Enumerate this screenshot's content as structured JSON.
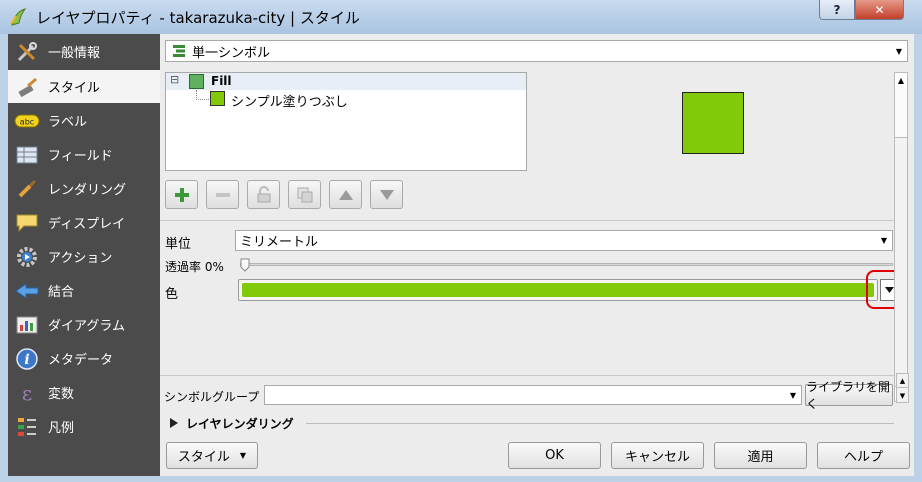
{
  "window": {
    "title": "レイヤプロパティ - takarazuka-city | スタイル",
    "help_label": "?",
    "close_label": "✕"
  },
  "sidebar": {
    "items": [
      {
        "label": "一般情報",
        "icon": "tools-icon"
      },
      {
        "label": "スタイル",
        "icon": "paintbrush-icon"
      },
      {
        "label": "ラベル",
        "icon": "abc-label-icon"
      },
      {
        "label": "フィールド",
        "icon": "table-icon"
      },
      {
        "label": "レンダリング",
        "icon": "brush-icon"
      },
      {
        "label": "ディスプレイ",
        "icon": "speech-bubble-icon"
      },
      {
        "label": "アクション",
        "icon": "gear-icon"
      },
      {
        "label": "結合",
        "icon": "join-arrow-icon"
      },
      {
        "label": "ダイアグラム",
        "icon": "diagram-icon"
      },
      {
        "label": "メタデータ",
        "icon": "info-icon"
      },
      {
        "label": "変数",
        "icon": "epsilon-icon"
      },
      {
        "label": "凡例",
        "icon": "legend-icon"
      }
    ]
  },
  "renderer": {
    "selected": "単一シンボル"
  },
  "symbol_tree": {
    "root": "Fill",
    "child": "シンプル塗りつぶし",
    "expand_symbol": "⊟"
  },
  "symbol_color": "#82c90a",
  "form": {
    "unit_label": "単位",
    "unit_value": "ミリメートル",
    "opacity_label": "透過率 0%",
    "color_label": "色"
  },
  "symbol_group": {
    "label": "シンボルグループ",
    "value": "",
    "open_library_label": "ライブラリを開く"
  },
  "layer_rendering": {
    "label": "レイヤレンダリング"
  },
  "buttons": {
    "style": "スタイル",
    "ok": "OK",
    "cancel": "キャンセル",
    "apply": "適用",
    "help": "ヘルプ"
  }
}
